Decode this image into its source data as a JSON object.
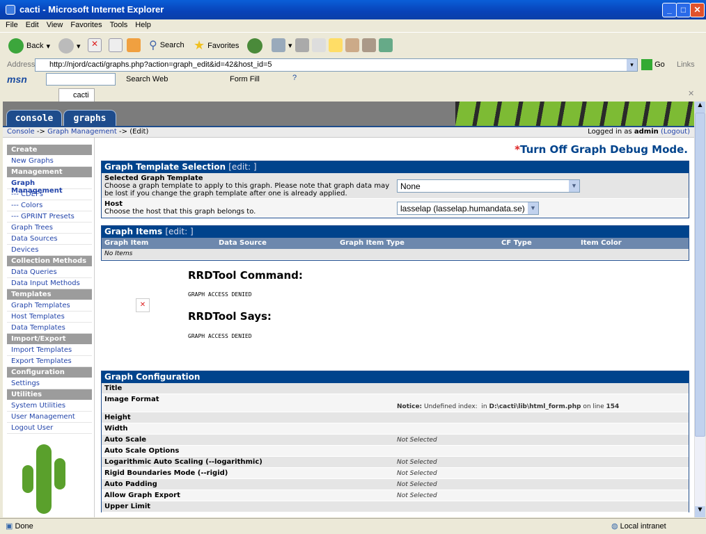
{
  "window": {
    "title": "cacti - Microsoft Internet Explorer"
  },
  "menu": [
    "File",
    "Edit",
    "View",
    "Favorites",
    "Tools",
    "Help"
  ],
  "toolbar": {
    "back": "Back",
    "search": "Search",
    "favorites": "Favorites"
  },
  "address": {
    "label": "Address",
    "url": "http://njord/cacti/graphs.php?action=graph_edit&id=42&host_id=5",
    "go": "Go",
    "links": "Links"
  },
  "msn": {
    "logo": "msn",
    "search_web": "Search Web",
    "form_fill": "Form Fill"
  },
  "browser_tab": "cacti",
  "cacti": {
    "tabs": [
      "console",
      "graphs"
    ],
    "breadcrumb": {
      "console": "Console",
      "sep": "->",
      "graph_mgmt": "Graph Management",
      "edit": "(Edit)"
    },
    "login": {
      "prefix": "Logged in as",
      "user": "admin",
      "logout": "(Logout)"
    }
  },
  "sidebar": [
    {
      "t": "h",
      "label": "Create"
    },
    {
      "t": "i",
      "label": "New Graphs"
    },
    {
      "t": "h",
      "label": "Management"
    },
    {
      "t": "a",
      "label": "Graph Management"
    },
    {
      "t": "i",
      "label": "--- CDEFs"
    },
    {
      "t": "i",
      "label": "--- Colors"
    },
    {
      "t": "i",
      "label": "--- GPRINT Presets"
    },
    {
      "t": "i",
      "label": "Graph Trees"
    },
    {
      "t": "i",
      "label": "Data Sources"
    },
    {
      "t": "i",
      "label": "Devices"
    },
    {
      "t": "h",
      "label": "Collection Methods"
    },
    {
      "t": "i",
      "label": "Data Queries"
    },
    {
      "t": "i",
      "label": "Data Input Methods"
    },
    {
      "t": "h",
      "label": "Templates"
    },
    {
      "t": "i",
      "label": "Graph Templates"
    },
    {
      "t": "i",
      "label": "Host Templates"
    },
    {
      "t": "i",
      "label": "Data Templates"
    },
    {
      "t": "h",
      "label": "Import/Export"
    },
    {
      "t": "i",
      "label": "Import Templates"
    },
    {
      "t": "i",
      "label": "Export Templates"
    },
    {
      "t": "h",
      "label": "Configuration"
    },
    {
      "t": "i",
      "label": "Settings"
    },
    {
      "t": "h",
      "label": "Utilities"
    },
    {
      "t": "i",
      "label": "System Utilities"
    },
    {
      "t": "i",
      "label": "User Management"
    },
    {
      "t": "i",
      "label": "Logout User"
    }
  ],
  "main": {
    "debug": {
      "star": "*",
      "label": "Turn Off Graph Debug Mode."
    },
    "template_sel": {
      "title": "Graph Template Selection",
      "edit": "[edit: ]",
      "tmpl_label": "Selected Graph Template",
      "tmpl_desc": "Choose a graph template to apply to this graph. Please note that graph data may be lost if you change the graph template after one is already applied.",
      "tmpl_value": "None",
      "host_label": "Host",
      "host_desc": "Choose the host that this graph belongs to.",
      "host_value": "lasselap (lasselap.humandata.se)"
    },
    "items": {
      "title": "Graph Items",
      "edit": "[edit: ]",
      "cols": [
        "Graph Item",
        "Data Source",
        "Graph Item Type",
        "CF Type",
        "Item Color"
      ],
      "empty": "No Items"
    },
    "rrd": {
      "cmd_title": "RRDTool Command:",
      "cmd": "GRAPH ACCESS DENIED",
      "says_title": "RRDTool Says:",
      "says": "GRAPH ACCESS DENIED"
    },
    "config": {
      "title": "Graph Configuration",
      "rows": [
        {
          "label": "Title",
          "value": ""
        },
        {
          "label": "Image Format",
          "value": "",
          "notice": {
            "b1": "Notice:",
            "t1": " Undefined index:  in ",
            "b2": "D:\\cacti\\lib\\html_form.php",
            "t2": " on line ",
            "b3": "154"
          }
        },
        {
          "label": "Height",
          "value": ""
        },
        {
          "label": "Width",
          "value": ""
        },
        {
          "label": "Auto Scale",
          "value": "Not Selected"
        },
        {
          "label": "Auto Scale Options",
          "value": ""
        },
        {
          "label": "Logarithmic Auto Scaling (--logarithmic)",
          "value": "Not Selected"
        },
        {
          "label": "Rigid Boundaries Mode (--rigid)",
          "value": "Not Selected"
        },
        {
          "label": "Auto Padding",
          "value": "Not Selected"
        },
        {
          "label": "Allow Graph Export",
          "value": "Not Selected"
        },
        {
          "label": "Upper Limit",
          "value": ""
        }
      ]
    }
  },
  "status": {
    "left": "Done",
    "zone": "Local intranet"
  }
}
